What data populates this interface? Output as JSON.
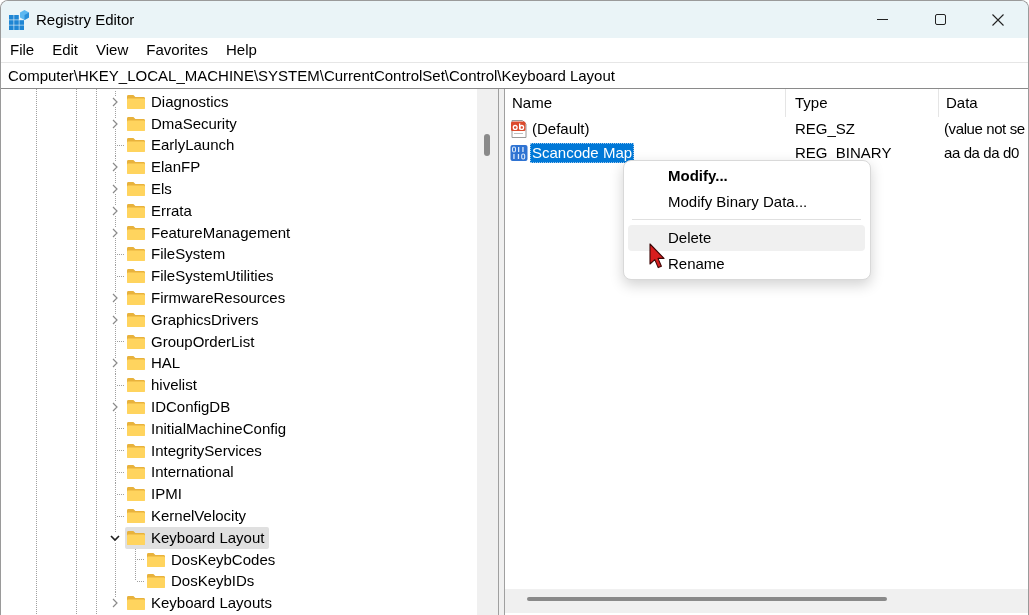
{
  "window": {
    "title": "Registry Editor"
  },
  "menu_bar": [
    "File",
    "Edit",
    "View",
    "Favorites",
    "Help"
  ],
  "address_bar": {
    "value": "Computer\\HKEY_LOCAL_MACHINE\\SYSTEM\\CurrentControlSet\\Control\\Keyboard Layout"
  },
  "tree": {
    "items": [
      {
        "label": "Diagnostics",
        "expandable": true,
        "expanded": false,
        "selected": false
      },
      {
        "label": "DmaSecurity",
        "expandable": true,
        "expanded": false,
        "selected": false
      },
      {
        "label": "EarlyLaunch",
        "expandable": false,
        "expanded": false,
        "selected": false
      },
      {
        "label": "ElanFP",
        "expandable": true,
        "expanded": false,
        "selected": false
      },
      {
        "label": "Els",
        "expandable": true,
        "expanded": false,
        "selected": false
      },
      {
        "label": "Errata",
        "expandable": true,
        "expanded": false,
        "selected": false
      },
      {
        "label": "FeatureManagement",
        "expandable": true,
        "expanded": false,
        "selected": false
      },
      {
        "label": "FileSystem",
        "expandable": false,
        "expanded": false,
        "selected": false
      },
      {
        "label": "FileSystemUtilities",
        "expandable": false,
        "expanded": false,
        "selected": false
      },
      {
        "label": "FirmwareResources",
        "expandable": true,
        "expanded": false,
        "selected": false
      },
      {
        "label": "GraphicsDrivers",
        "expandable": true,
        "expanded": false,
        "selected": false
      },
      {
        "label": "GroupOrderList",
        "expandable": false,
        "expanded": false,
        "selected": false
      },
      {
        "label": "HAL",
        "expandable": true,
        "expanded": false,
        "selected": false
      },
      {
        "label": "hivelist",
        "expandable": false,
        "expanded": false,
        "selected": false
      },
      {
        "label": "IDConfigDB",
        "expandable": true,
        "expanded": false,
        "selected": false
      },
      {
        "label": "InitialMachineConfig",
        "expandable": false,
        "expanded": false,
        "selected": false
      },
      {
        "label": "IntegrityServices",
        "expandable": false,
        "expanded": false,
        "selected": false
      },
      {
        "label": "International",
        "expandable": false,
        "expanded": false,
        "selected": false
      },
      {
        "label": "IPMI",
        "expandable": false,
        "expanded": false,
        "selected": false
      },
      {
        "label": "KernelVelocity",
        "expandable": false,
        "expanded": false,
        "selected": false
      },
      {
        "label": "Keyboard Layout",
        "expandable": true,
        "expanded": true,
        "selected": true,
        "children": [
          {
            "label": "DosKeybCodes",
            "expandable": false,
            "expanded": false,
            "selected": false
          },
          {
            "label": "DosKeybIDs",
            "expandable": false,
            "expanded": false,
            "selected": false
          }
        ]
      },
      {
        "label": "Keyboard Layouts",
        "expandable": true,
        "expanded": false,
        "selected": false
      }
    ]
  },
  "values": {
    "columns": [
      "Name",
      "Type",
      "Data"
    ],
    "rows": [
      {
        "kind": "string",
        "name": "(Default)",
        "type": "REG_SZ",
        "data": "(value not se",
        "selected": false
      },
      {
        "kind": "binary",
        "name": "Scancode Map",
        "type": "REG_BINARY",
        "data": "aa da da d0",
        "selected": true
      }
    ]
  },
  "context_menu": {
    "items": [
      {
        "label": "Modify...",
        "default": true,
        "separator_before": false,
        "selected": false
      },
      {
        "label": "Modify Binary Data...",
        "default": false,
        "separator_before": false,
        "selected": false
      },
      {
        "label": "Delete",
        "default": false,
        "separator_before": true,
        "selected": true
      },
      {
        "label": "Rename",
        "default": false,
        "separator_before": false,
        "selected": false
      }
    ]
  }
}
